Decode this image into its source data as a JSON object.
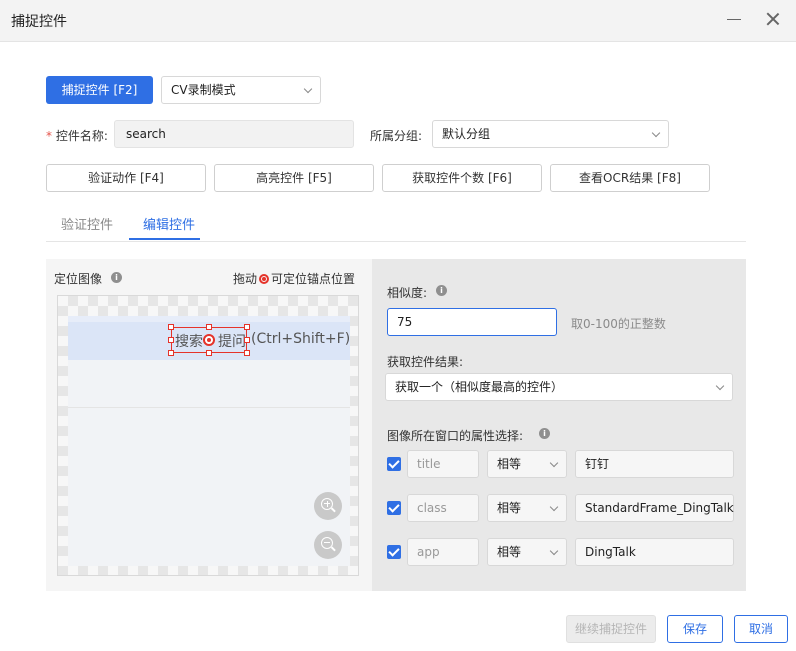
{
  "window": {
    "title": "捕捉控件"
  },
  "toolbar": {
    "capture_label": "捕捉控件 [F2]",
    "mode_value": "CV录制模式"
  },
  "form": {
    "name_label": "控件名称:",
    "name_required_mark": "*",
    "name_value": "search",
    "group_label": "所属分组:",
    "group_value": "默认分组"
  },
  "actions": {
    "verify": "验证动作 [F4]",
    "highlight": "高亮控件 [F5]",
    "count": "获取控件个数 [F6]",
    "ocr": "查看OCR结果 [F8]"
  },
  "tabs": [
    {
      "label": "验证控件",
      "active": false
    },
    {
      "label": "编辑控件",
      "active": true
    }
  ],
  "image_panel": {
    "title": "定位图像",
    "drag_hint_prefix": "拖动",
    "drag_hint_suffix": "可定位锚点位置",
    "captured_text_a": "搜索",
    "captured_text_b": "提问",
    "captured_text_c": "(Ctrl+Shift+F)",
    "zoom_in_icon": "zoom-in-icon",
    "zoom_out_icon": "zoom-out-icon"
  },
  "settings": {
    "similarity_label": "相似度:",
    "similarity_value": "75",
    "similarity_hint": "取0-100的正整数",
    "result_label": "获取控件结果:",
    "result_value": "获取一个（相似度最高的控件）",
    "attrs_label": "图像所在窗口的属性选择:",
    "attributes": [
      {
        "name": "title",
        "operator": "相等",
        "value": "钉钉",
        "checked": true
      },
      {
        "name": "class",
        "operator": "相等",
        "value": "StandardFrame_DingTalk",
        "checked": true
      },
      {
        "name": "app",
        "operator": "相等",
        "value": "DingTalk",
        "checked": true
      }
    ]
  },
  "footer": {
    "continue_label": "继续捕捉控件",
    "save_label": "保存",
    "cancel_label": "取消"
  },
  "colors": {
    "accent": "#2f6fe4",
    "selection": "#e5332a"
  }
}
